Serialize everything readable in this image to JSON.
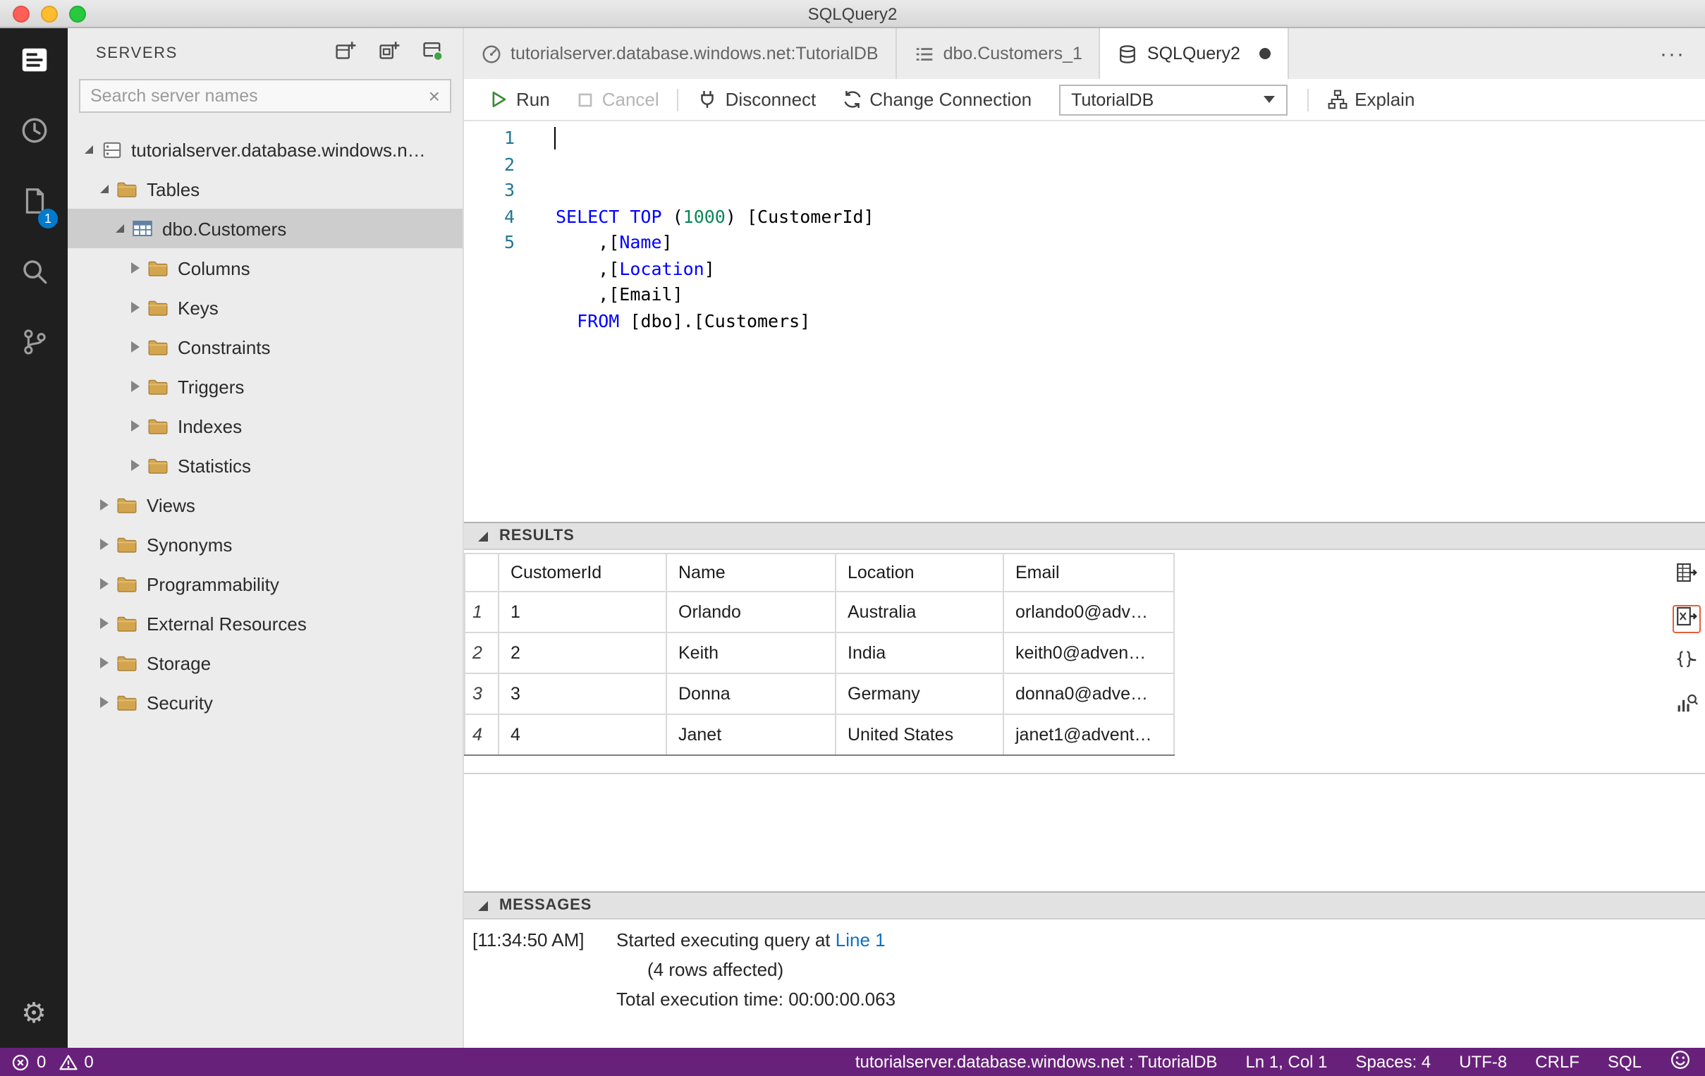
{
  "window": {
    "title": "SQLQuery2"
  },
  "activity_bar": {
    "items": [
      {
        "icon": "servers",
        "active": true
      },
      {
        "icon": "task-history",
        "active": false
      },
      {
        "icon": "query-editor",
        "active": false,
        "badge": "1"
      },
      {
        "icon": "search",
        "active": false
      },
      {
        "icon": "source-control",
        "active": false
      }
    ],
    "bottom": {
      "icon": "settings",
      "glyph": "⚙"
    }
  },
  "sidebar": {
    "title": "SERVERS",
    "actions": [
      {
        "icon": "new-connection"
      },
      {
        "icon": "new-server-group"
      },
      {
        "icon": "active-connections"
      }
    ],
    "search": {
      "placeholder": "Search server names",
      "value": "",
      "clear_icon": "×"
    },
    "tree": [
      {
        "label": "tutorialserver.database.windows.n…",
        "level": 0,
        "state": "expanded",
        "icon": "server",
        "selected": false
      },
      {
        "label": "Tables",
        "level": 1,
        "state": "expanded",
        "icon": "folder",
        "selected": false
      },
      {
        "label": "dbo.Customers",
        "level": 2,
        "state": "expanded",
        "icon": "table",
        "selected": true
      },
      {
        "label": "Columns",
        "level": 3,
        "state": "collapsed",
        "icon": "folder",
        "selected": false
      },
      {
        "label": "Keys",
        "level": 3,
        "state": "collapsed",
        "icon": "folder",
        "selected": false
      },
      {
        "label": "Constraints",
        "level": 3,
        "state": "collapsed",
        "icon": "folder",
        "selected": false
      },
      {
        "label": "Triggers",
        "level": 3,
        "state": "collapsed",
        "icon": "folder",
        "selected": false
      },
      {
        "label": "Indexes",
        "level": 3,
        "state": "collapsed",
        "icon": "folder",
        "selected": false
      },
      {
        "label": "Statistics",
        "level": 3,
        "state": "collapsed",
        "icon": "folder",
        "selected": false
      },
      {
        "label": "Views",
        "level": 1,
        "state": "collapsed",
        "icon": "folder",
        "selected": false
      },
      {
        "label": "Synonyms",
        "level": 1,
        "state": "collapsed",
        "icon": "folder",
        "selected": false
      },
      {
        "label": "Programmability",
        "level": 1,
        "state": "collapsed",
        "icon": "folder",
        "selected": false
      },
      {
        "label": "External Resources",
        "level": 1,
        "state": "collapsed",
        "icon": "folder",
        "selected": false
      },
      {
        "label": "Storage",
        "level": 1,
        "state": "collapsed",
        "icon": "folder",
        "selected": false
      },
      {
        "label": "Security",
        "level": 1,
        "state": "collapsed",
        "icon": "folder",
        "selected": false
      }
    ]
  },
  "tab_bar": {
    "tabs": [
      {
        "label": "tutorialserver.database.windows.net:TutorialDB",
        "icon": "dashboard",
        "active": false,
        "dirty": false
      },
      {
        "label": "dbo.Customers_1",
        "icon": "data-table",
        "active": false,
        "dirty": false
      },
      {
        "label": "SQLQuery2",
        "icon": "database",
        "active": true,
        "dirty": true
      }
    ],
    "more_icon": "···"
  },
  "toolbar": {
    "run": "Run",
    "cancel": "Cancel",
    "disconnect": "Disconnect",
    "change_connection": "Change Connection",
    "database_dropdown": {
      "value": "TutorialDB"
    },
    "explain": "Explain"
  },
  "editor": {
    "lines": [
      {
        "num": "1",
        "segments": [
          {
            "text": "SELECT",
            "type": "keyword"
          },
          {
            "text": " ",
            "type": "plain"
          },
          {
            "text": "TOP",
            "type": "keyword"
          },
          {
            "text": " (",
            "type": "plain"
          },
          {
            "text": "1000",
            "type": "number"
          },
          {
            "text": ") [CustomerId]",
            "type": "plain"
          }
        ]
      },
      {
        "num": "2",
        "segments": [
          {
            "text": "    ,[",
            "type": "plain"
          },
          {
            "text": "Name",
            "type": "keyword"
          },
          {
            "text": "]",
            "type": "plain"
          }
        ]
      },
      {
        "num": "3",
        "segments": [
          {
            "text": "    ,[",
            "type": "plain"
          },
          {
            "text": "Location",
            "type": "keyword"
          },
          {
            "text": "]",
            "type": "plain"
          }
        ]
      },
      {
        "num": "4",
        "segments": [
          {
            "text": "    ,[Email]",
            "type": "plain"
          }
        ]
      },
      {
        "num": "5",
        "segments": [
          {
            "text": "  ",
            "type": "plain"
          },
          {
            "text": "FROM",
            "type": "keyword"
          },
          {
            "text": " [dbo].[Customers]",
            "type": "plain"
          }
        ]
      }
    ]
  },
  "results": {
    "header": "RESULTS",
    "columns": [
      "CustomerId",
      "Name",
      "Location",
      "Email"
    ],
    "rows": [
      {
        "num": "1",
        "cells": [
          "1",
          "Orlando",
          "Australia",
          "orlando0@adv…"
        ]
      },
      {
        "num": "2",
        "cells": [
          "2",
          "Keith",
          "India",
          "keith0@adven…"
        ]
      },
      {
        "num": "3",
        "cells": [
          "3",
          "Donna",
          "Germany",
          "donna0@adve…"
        ]
      },
      {
        "num": "4",
        "cells": [
          "4",
          "Janet",
          "United States",
          "janet1@advent…"
        ]
      }
    ],
    "actions": [
      {
        "icon": "export-csv",
        "highlighted": false
      },
      {
        "icon": "export-excel",
        "highlighted": true
      },
      {
        "icon": "export-json",
        "highlighted": false
      },
      {
        "icon": "view-chart",
        "highlighted": false
      }
    ]
  },
  "messages": {
    "header": "MESSAGES",
    "items": [
      {
        "timestamp": "[11:34:50 AM]",
        "text": "Started executing query at ",
        "link": "Line 1",
        "indent": false
      },
      {
        "timestamp": "",
        "text": "(4 rows affected)",
        "indent": true
      },
      {
        "timestamp": "",
        "text": "Total execution time: 00:00:00.063",
        "indent": false
      }
    ]
  },
  "status_bar": {
    "errors": "0",
    "warnings": "0",
    "items": [
      {
        "name": "connection-status",
        "label": "tutorialserver.database.windows.net : TutorialDB"
      },
      {
        "name": "cursor-position",
        "label": "Ln 1, Col 1"
      },
      {
        "name": "indentation",
        "label": "Spaces: 4"
      },
      {
        "name": "encoding",
        "label": "UTF-8"
      },
      {
        "name": "eol",
        "label": "CRLF"
      },
      {
        "name": "language-mode",
        "label": "SQL"
      }
    ]
  },
  "colors": {
    "status_bar_bg": "#68217A",
    "keyword": "#0000ff",
    "number": "#098658",
    "link": "#0e70c0",
    "badge": "#007acc",
    "highlight_border": "#e2603a"
  }
}
